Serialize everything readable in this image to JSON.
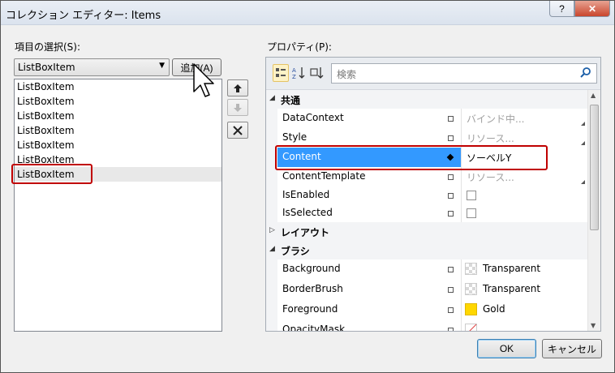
{
  "window": {
    "title": "コレクション エディター: Items",
    "help_label": "?",
    "close_label": "✕"
  },
  "left": {
    "label": "項目の選択(S):",
    "combo_value": "ListBoxItem",
    "add_label": "追加(A)",
    "items": [
      "ListBoxItem",
      "ListBoxItem",
      "ListBoxItem",
      "ListBoxItem",
      "ListBoxItem",
      "ListBoxItem",
      "ListBoxItem"
    ],
    "selected_index": 6
  },
  "right": {
    "label": "プロパティ(P):",
    "search_placeholder": "検索",
    "categories": {
      "common": "共通",
      "layout": "レイアウト",
      "brush": "ブラシ"
    },
    "properties": {
      "datacontext": {
        "name": "DataContext",
        "value": "バインド中..."
      },
      "style": {
        "name": "Style",
        "value": "リソース..."
      },
      "content": {
        "name": "Content",
        "value": "ソーベルY"
      },
      "contenttemplate": {
        "name": "ContentTemplate",
        "value": "リソース..."
      },
      "isenabled": {
        "name": "IsEnabled",
        "checked": false
      },
      "isselected": {
        "name": "IsSelected",
        "checked": false
      },
      "background": {
        "name": "Background",
        "value": "Transparent"
      },
      "borderbrush": {
        "name": "BorderBrush",
        "value": "Transparent"
      },
      "foreground": {
        "name": "Foreground",
        "value": "Gold",
        "color": "#ffd700"
      },
      "opacitymask": {
        "name": "OpacityMask",
        "value": ""
      }
    }
  },
  "footer": {
    "ok_label": "OK",
    "cancel_label": "キャンセル"
  },
  "colors": {
    "selection": "#3399ff",
    "highlight_border": "#c00000",
    "gold": "#ffd700"
  }
}
